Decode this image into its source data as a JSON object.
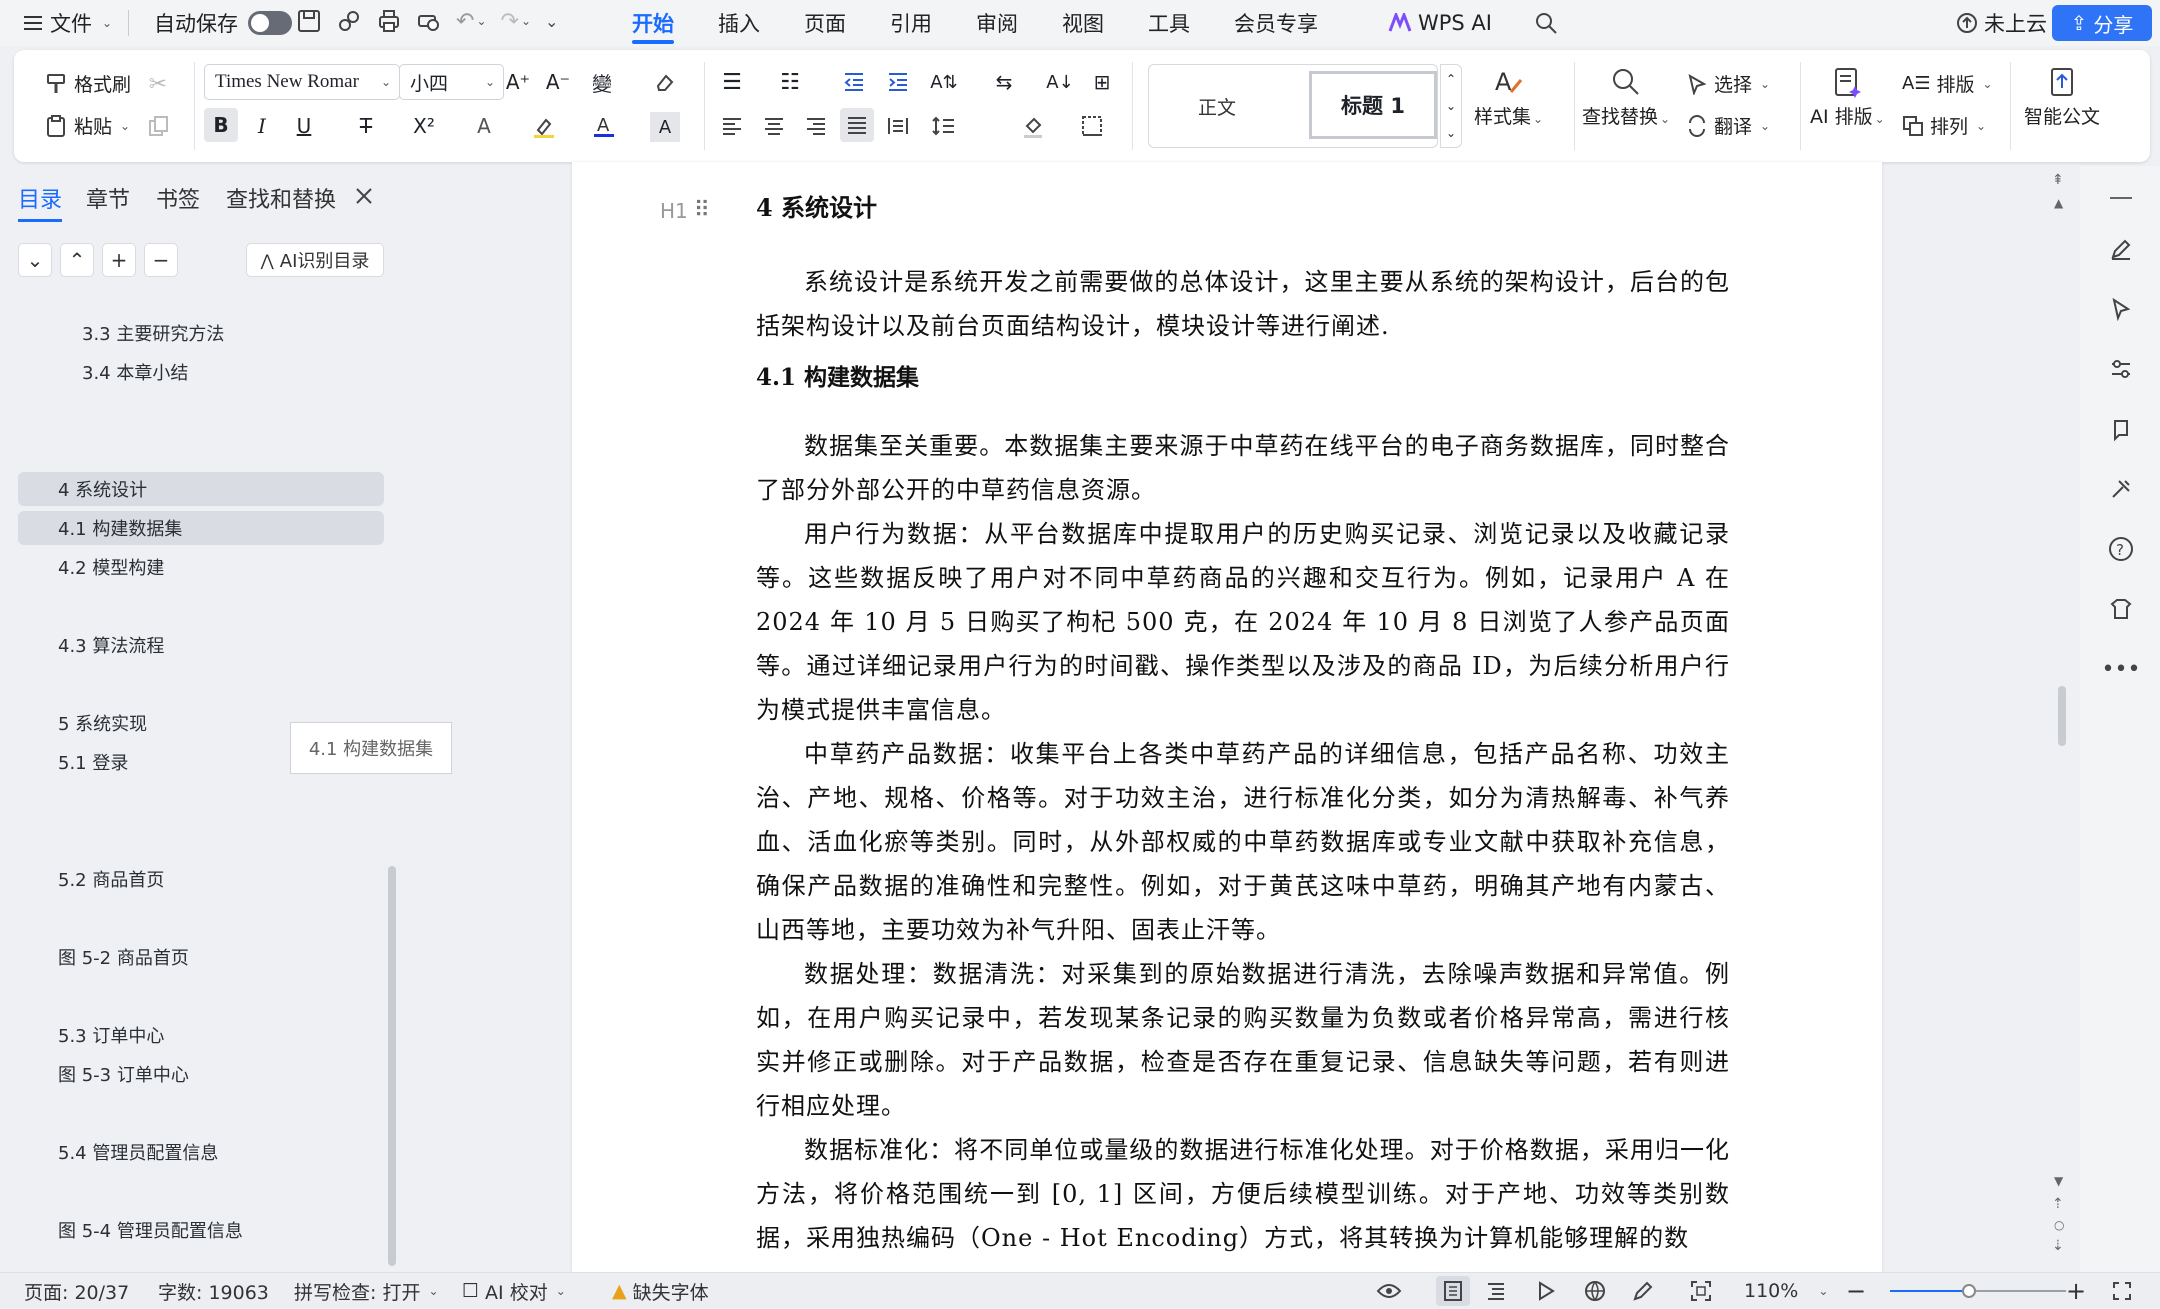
{
  "menubar": {
    "file": "文件",
    "autosave": "自动保存",
    "tabs": [
      "开始",
      "插入",
      "页面",
      "引用",
      "审阅",
      "视图",
      "工具",
      "会员专享"
    ],
    "wps_ai": "WPS AI",
    "cloud": "未上云",
    "share": "分享"
  },
  "ribbon": {
    "format_painter": "格式刷",
    "paste": "粘贴",
    "font_name": "Times New Romar",
    "font_size": "小四",
    "style_normal": "正文",
    "style_heading1": "标题 1",
    "style_set": "样式集",
    "find_replace": "查找替换",
    "select": "选择",
    "translate": "翻译",
    "ai_layout": "AI 排版",
    "layout": "排版",
    "arrange": "排列",
    "smart_doc": "智能公文"
  },
  "sidebar": {
    "tabs": [
      "目录",
      "章节",
      "书签",
      "查找和替换"
    ],
    "ai_toc": "AI识别目录",
    "toc": [
      {
        "label": "3.3 主要研究方法"
      },
      {
        "label": "3.4 本章小结"
      },
      {
        "label": "4  系统设计"
      },
      {
        "label": "4.1  构建数据集"
      },
      {
        "label": "4.2  模型构建"
      },
      {
        "label": "4.3  算法流程"
      },
      {
        "label": "5 系统实现"
      },
      {
        "label": "5.1  登录"
      },
      {
        "label": "5.2  商品首页"
      },
      {
        "label": "图 5-2 商品首页"
      },
      {
        "label": "5.3 订单中心"
      },
      {
        "label": "图 5-3 订单中心"
      },
      {
        "label": "5.4  管理员配置信息"
      },
      {
        "label": "图 5-4  管理员配置信息"
      }
    ],
    "tooltip": "4.1 构建数据集"
  },
  "document": {
    "heading_marker": "H1",
    "h1": "4  系统设计",
    "p1": "系统设计是系统开发之前需要做的总体设计，这里主要从系统的架构设计，后台的包括架构设计以及前台页面结构设计，模块设计等进行阐述.",
    "h2": "4.1  构建数据集",
    "p2": "数据集至关重要。本数据集主要来源于中草药在线平台的电子商务数据库，同时整合了部分外部公开的中草药信息资源。",
    "p3": "用户行为数据：从平台数据库中提取用户的历史购买记录、浏览记录以及收藏记录等。这些数据反映了用户对不同中草药商品的兴趣和交互行为。例如，记录用户 A 在 2024 年 10 月 5 日购买了枸杞 500 克，在 2024 年 10 月 8 日浏览了人参产品页面等。通过详细记录用户行为的时间戳、操作类型以及涉及的商品 ID，为后续分析用户行为模式提供丰富信息。",
    "p4": "中草药产品数据：收集平台上各类中草药产品的详细信息，包括产品名称、功效主治、产地、规格、价格等。对于功效主治，进行标准化分类，如分为清热解毒、补气养血、活血化瘀等类别。同时，从外部权威的中草药数据库或专业文献中获取补充信息，确保产品数据的准确性和完整性。例如，对于黄芪这味中草药，明确其产地有内蒙古、山西等地，主要功效为补气升阳、固表止汗等。",
    "p5": "数据处理：数据清洗：对采集到的原始数据进行清洗，去除噪声数据和异常值。例如，在用户购买记录中，若发现某条记录的购买数量为负数或者价格异常高，需进行核实并修正或删除。对于产品数据，检查是否存在重复记录、信息缺失等问题，若有则进行相应处理。",
    "p6": "数据标准化：将不同单位或量级的数据进行标准化处理。对于价格数据，采用归一化方法，将价格范围统一到 [0, 1] 区间，方便后续模型训练。对于产地、功效等类别数据，采用独热编码（One - Hot Encoding）方式，将其转换为计算机能够理解的数"
  },
  "statusbar": {
    "page": "页面: 20/37",
    "words": "字数: 19063",
    "spell": "拼写检查: 打开",
    "ai_check": "AI 校对",
    "missing_font": "缺失字体",
    "zoom": "110%"
  }
}
